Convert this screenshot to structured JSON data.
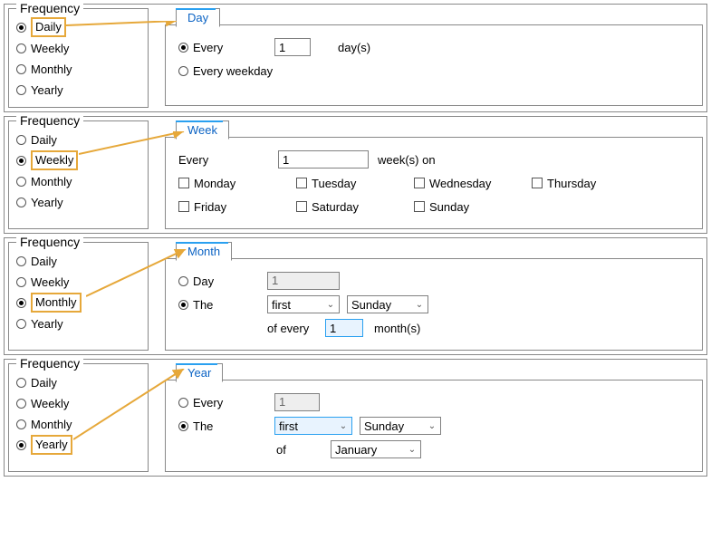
{
  "frequency_label": "Frequency",
  "options": {
    "daily": "Daily",
    "weekly": "Weekly",
    "monthly": "Monthly",
    "yearly": "Yearly"
  },
  "tabs": {
    "day": "Day",
    "week": "Week",
    "month": "Month",
    "year": "Year"
  },
  "day": {
    "every": "Every",
    "value": "1",
    "days_suffix": "day(s)",
    "every_weekday": "Every weekday"
  },
  "week": {
    "every": "Every",
    "value": "1",
    "weeks_on": "week(s) on",
    "days": [
      "Monday",
      "Tuesday",
      "Wednesday",
      "Thursday",
      "Friday",
      "Saturday",
      "Sunday"
    ]
  },
  "month": {
    "day": "Day",
    "day_value": "1",
    "the": "The",
    "ordinal": "first",
    "weekday": "Sunday",
    "of_every": "of every",
    "nvalue": "1",
    "months_suffix": "month(s)"
  },
  "year": {
    "every": "Every",
    "every_value": "1",
    "the": "The",
    "ordinal": "first",
    "weekday": "Sunday",
    "of": "of",
    "month": "January"
  }
}
